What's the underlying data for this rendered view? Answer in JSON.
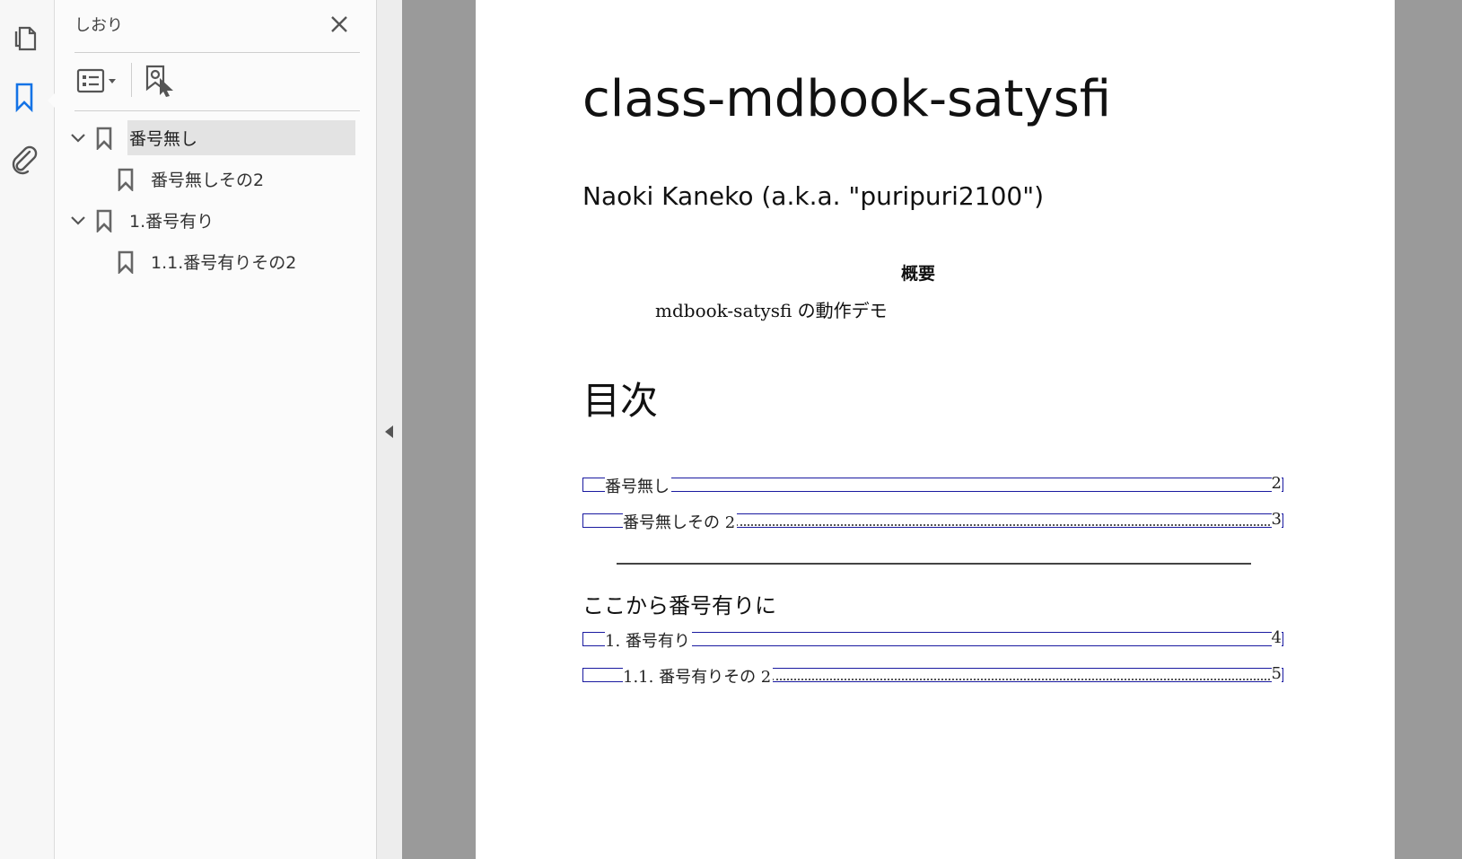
{
  "rail": {
    "items": [
      {
        "icon": "page-thumbnails-icon"
      },
      {
        "icon": "bookmark-icon",
        "active": true
      },
      {
        "icon": "attachment-icon"
      }
    ],
    "accent_color": "#1473e6"
  },
  "bookmarks_panel": {
    "title": "しおり",
    "items": [
      {
        "label": "番号無し",
        "level": 0,
        "expanded": true,
        "selected": true
      },
      {
        "label": "番号無しその2",
        "level": 1
      },
      {
        "label": "1.番号有り",
        "level": 0,
        "expanded": true
      },
      {
        "label": "1.1.番号有りその2",
        "level": 1
      }
    ]
  },
  "document": {
    "title": "class-mdbook-satysfi",
    "author": "Naoki Kaneko (a.k.a. \"puripuri2100\")",
    "abstract_heading": "概要",
    "abstract_text": "mdbook-satysfi の動作デモ",
    "toc_heading": "目次",
    "toc": [
      {
        "text": "番号無し",
        "page": "2",
        "indent": 0,
        "dotted": false
      },
      {
        "text": "番号無しその 2",
        "page": "3",
        "indent": 1,
        "dotted": true
      },
      {
        "text": "1. 番号有り",
        "page": "4",
        "indent": 0,
        "dotted": false
      },
      {
        "text": "1.1. 番号有りその 2",
        "page": "5",
        "indent": 1,
        "dotted": true
      }
    ],
    "section_heading": "ここから番号有りに"
  }
}
